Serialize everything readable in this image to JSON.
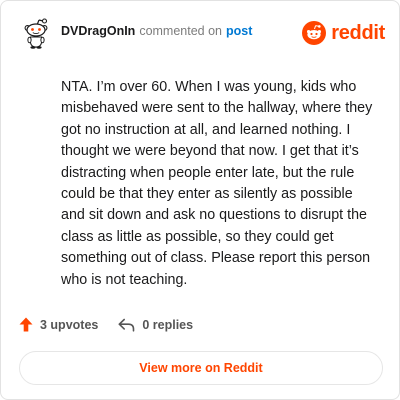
{
  "header": {
    "author": "DVDragOnIn",
    "action": "commented on",
    "post_link": "post",
    "brand": "reddit"
  },
  "comment": {
    "body": "NTA. I’m over 60. When I was young, kids who misbehaved were sent to the hallway, where they got no instruction at all, and learned nothing. I thought we were beyond that now. I get that it’s distracting when people enter late, but the rule could be that they enter as silently as possible and sit down and ask no questions to disrupt the class as little as possible, so they could get something out of class. Please report this person who is not teaching."
  },
  "footer": {
    "upvotes": "3 upvotes",
    "replies": "0 replies"
  },
  "button": {
    "view": "View more on Reddit"
  },
  "icons": {
    "avatar": "snoo-avatar-icon",
    "brand": "reddit-logo-icon",
    "upvote": "upvote-arrow-icon",
    "reply": "reply-arrow-icon"
  },
  "colors": {
    "brand": "#ff4500",
    "link": "#0079d3",
    "text": "#1a1a1b",
    "muted": "#7c7c7c"
  }
}
